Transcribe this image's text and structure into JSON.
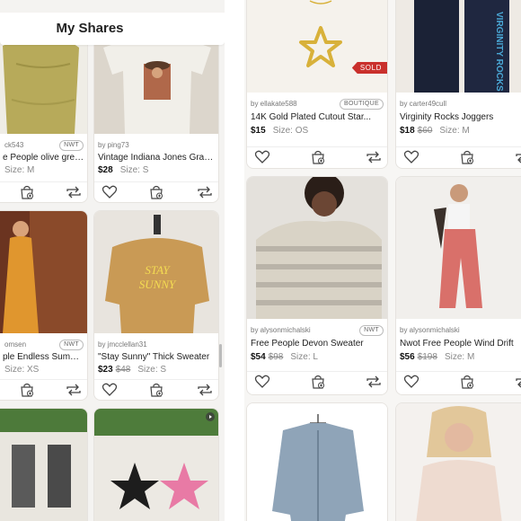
{
  "header": {
    "title": "My Shares"
  },
  "left_cards": [
    {
      "seller": "ck543",
      "badge": "NWT",
      "title": "e People olive green...",
      "price": "",
      "old_price": "",
      "size": "Size: M"
    },
    {
      "seller": "by ping73",
      "badge": "",
      "title": "Vintage Indiana Jones Graphi...",
      "price": "$28",
      "old_price": "",
      "size": "Size: S"
    },
    {
      "seller": "omsen",
      "badge": "NWT",
      "title": "ple Endless Summer...",
      "price": "",
      "old_price": "",
      "size": "Size: XS"
    },
    {
      "seller": "by jmcclellan31",
      "badge": "",
      "title": "\"Stay Sunny\" Thick Sweater",
      "price": "$23",
      "old_price": "$48",
      "size": "Size: S"
    }
  ],
  "right_cards": [
    {
      "seller": "by ellakate588",
      "badge": "BOUTIQUE",
      "title": "14K Gold Plated Cutout Star...",
      "price": "$15",
      "old_price": "",
      "size": "Size: OS",
      "status": "SOLD"
    },
    {
      "seller": "by carter49cull",
      "badge": "",
      "title": "Virginity Rocks Joggers",
      "price": "$18",
      "old_price": "$60",
      "size": "Size: M",
      "status": ""
    },
    {
      "seller": "by alysonmichalski",
      "badge": "NWT",
      "title": "Free People Devon Sweater",
      "price": "$54",
      "old_price": "$98",
      "size": "Size: L",
      "status": ""
    },
    {
      "seller": "by alysonmichalski",
      "badge": "",
      "title": "Nwot Free People Wind Drift",
      "price": "$56",
      "old_price": "$198",
      "size": "Size: M",
      "status": ""
    }
  ],
  "photo_text": {
    "sweater_print": "STAY SUNNY",
    "jogger_print": "VIRGINITY ROCKS"
  },
  "colors": {
    "sold_red": "#c9302c",
    "bg_left": "#f4f3f1",
    "bg_right": "#f7f6f4"
  },
  "icons": [
    "heart-icon",
    "bag-plus-icon",
    "repost-icon",
    "play-icon"
  ]
}
